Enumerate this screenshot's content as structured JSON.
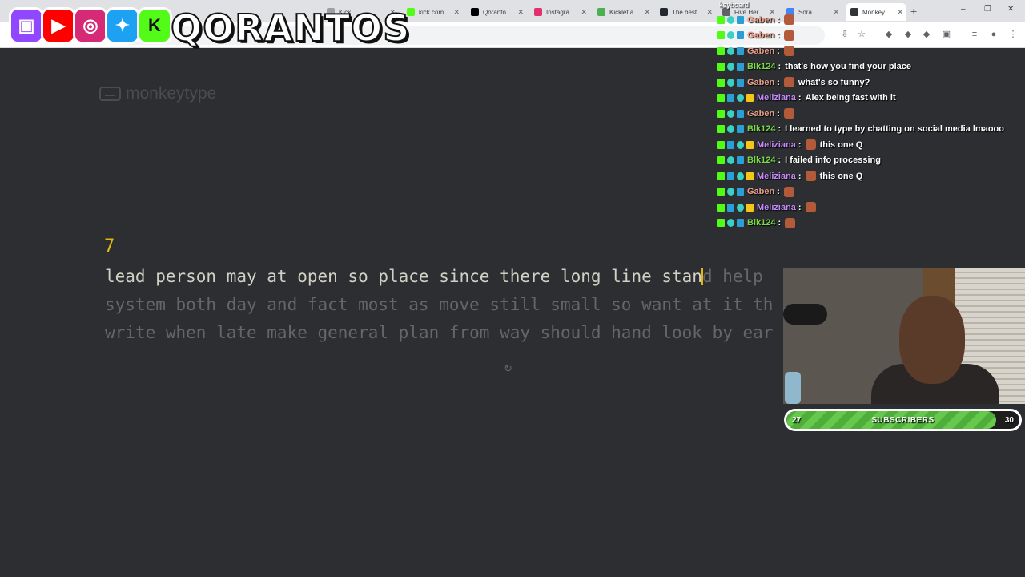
{
  "browser": {
    "tabs": [
      {
        "title": "Kick",
        "color": "#9aa0a6"
      },
      {
        "title": "kick.com",
        "color": "#53fc18"
      },
      {
        "title": "Qoranto",
        "color": "#000000"
      },
      {
        "title": "Instagra",
        "color": "#e1306c"
      },
      {
        "title": "Kicklet.a",
        "color": "#4caf50"
      },
      {
        "title": "The best",
        "color": "#24292f"
      },
      {
        "title": "Five Her",
        "color": "#5f6368"
      },
      {
        "title": "Sora",
        "color": "#4285f4"
      },
      {
        "title": "Monkey",
        "color": "#323437"
      }
    ],
    "new_tab": "+",
    "controls": [
      "–",
      "❐",
      "✕"
    ]
  },
  "overlay": {
    "brand_name": "QORANTOS",
    "social_icons": [
      "twitch-icon",
      "youtube-icon",
      "instagram-icon",
      "twitter-icon",
      "kick-icon"
    ]
  },
  "monkeytype": {
    "logo_text": "monkeytype",
    "timer": "7",
    "typed_text": "lead person may at open so place since there long line stan",
    "untyped_line1": "d help ",
    "line2": "system both day and fact most as move still small so want at it th",
    "line3": "write when late make general plan from way should hand look by ear",
    "restart_icon": "↻"
  },
  "chat": {
    "title": "keyboard",
    "messages": [
      {
        "author": "Gaben",
        "color": "#e8a08a",
        "text": "",
        "emote": true
      },
      {
        "author": "Gaben",
        "color": "#e8a08a",
        "text": "",
        "emote": true
      },
      {
        "author": "Gaben",
        "color": "#e8a08a",
        "text": "",
        "emote": true
      },
      {
        "author": "Blk124",
        "color": "#7bd84a",
        "text": "that's how you find your place",
        "emote": false
      },
      {
        "author": "Gaben",
        "color": "#e8a08a",
        "text": "what's so funny?",
        "emote": true
      },
      {
        "author": "Meliziana",
        "color": "#c58af9",
        "text": "Alex being fast with it",
        "emote": false
      },
      {
        "author": "Gaben",
        "color": "#e8a08a",
        "text": "",
        "emote": true
      },
      {
        "author": "Blk124",
        "color": "#7bd84a",
        "text": "I learned to type by chatting on social media lmaooo",
        "emote": false
      },
      {
        "author": "Meliziana",
        "color": "#c58af9",
        "text": "this one Q",
        "emote": true
      },
      {
        "author": "Blk124",
        "color": "#7bd84a",
        "text": "I failed info processing",
        "emote": false
      },
      {
        "author": "Meliziana",
        "color": "#c58af9",
        "text": "this one Q",
        "emote": true
      },
      {
        "author": "Gaben",
        "color": "#e8a08a",
        "text": "",
        "emote": true
      },
      {
        "author": "Meliziana",
        "color": "#c58af9",
        "text": "",
        "emote": true
      },
      {
        "author": "Blk124",
        "color": "#7bd84a",
        "text": "",
        "emote": true
      }
    ]
  },
  "subscriber_goal": {
    "current": "27",
    "label": "SUBSCRIBERS",
    "goal": "30",
    "progress_fraction": 0.9
  }
}
